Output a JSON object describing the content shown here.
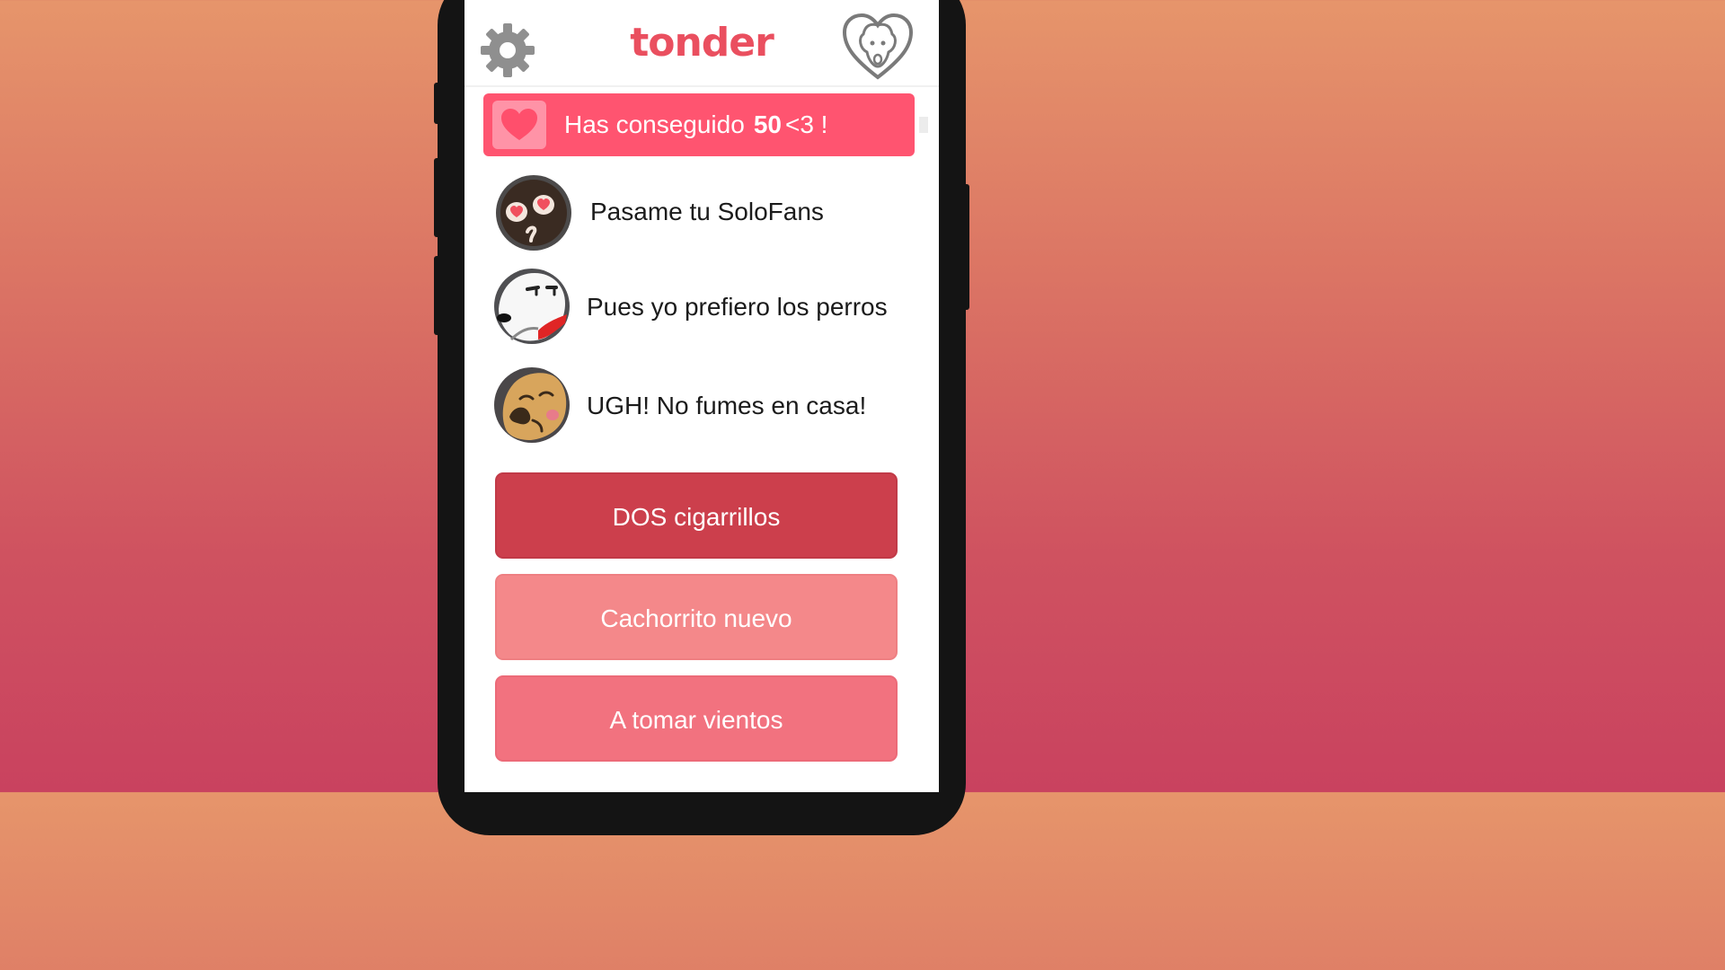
{
  "app": {
    "logo": "tonder"
  },
  "banner": {
    "prefix": "Has conseguido",
    "points": "50",
    "suffix": "<3 !"
  },
  "messages": [
    {
      "text": "Pasame tu SoloFans",
      "avatar": "heart-eyes-face-icon"
    },
    {
      "text": "Pues yo prefiero los perros",
      "avatar": "dog-face-icon"
    },
    {
      "text": "UGH! No fumes en casa!",
      "avatar": "llama-face-icon"
    }
  ],
  "options": [
    {
      "label": "DOS cigarrillos",
      "color": "#cc3f4c"
    },
    {
      "label": "Cachorrito nuevo",
      "color": "#f4888a"
    },
    {
      "label": "A tomar vientos",
      "color": "#f2727f"
    }
  ],
  "colors": {
    "brand": "#ea4f5f",
    "banner": "#ff5470",
    "background_top": "#e6956b",
    "background_bottom": "#c9425f"
  }
}
